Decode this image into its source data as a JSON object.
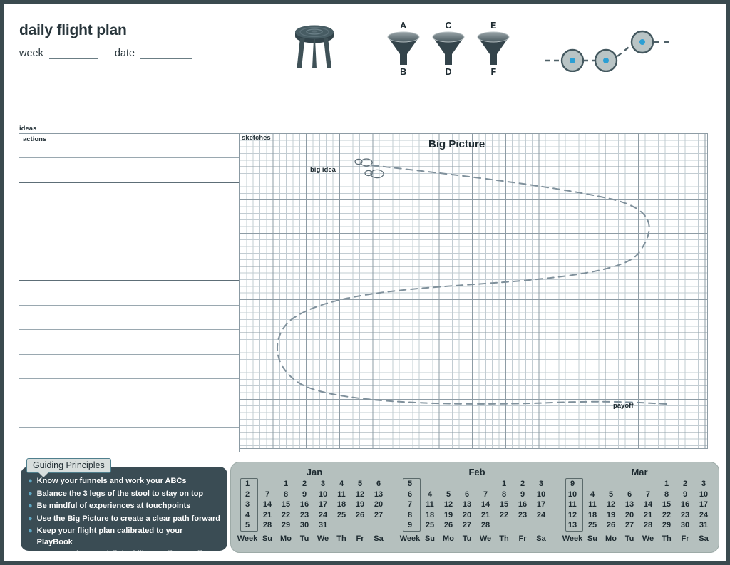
{
  "header": {
    "title": "daily flight plan",
    "week_label": "week",
    "date_label": "date",
    "stool_icon": "three-legged-stool-icon",
    "funnels": [
      {
        "top": "A",
        "bottom": "B"
      },
      {
        "top": "C",
        "bottom": "D"
      },
      {
        "top": "E",
        "bottom": "F"
      }
    ],
    "path_dots_icon": "ascending-path-dots-icon"
  },
  "left_panel": {
    "ideas_label": "ideas",
    "actions_label": "actions",
    "row_count": 13
  },
  "grid_panel": {
    "sketches_label": "sketches",
    "big_picture_title": "Big Picture",
    "big_idea_label": "big idea",
    "payoff_label": "payoff"
  },
  "guiding_principles": {
    "tab_label": "Guiding Principles",
    "items": [
      "Know your funnels and work your ABCs",
      "Balance the 3 legs of the stool to stay on top",
      "Be mindful of experiences at touchpoints",
      "Use the Big Picture to create a clear path forward",
      "Keep your flight plan calibrated to your PlayBook"
    ],
    "footer": "updates at delightability.com/free-stuff"
  },
  "calendars": {
    "week_header": "Week",
    "day_headers": [
      "Su",
      "Mo",
      "Tu",
      "We",
      "Th",
      "Fr",
      "Sa"
    ],
    "months": [
      {
        "name": "Jan",
        "weeks": [
          "1",
          "2",
          "3",
          "4",
          "5"
        ],
        "rows": [
          [
            "",
            "1",
            "2",
            "3",
            "4",
            "5",
            "6"
          ],
          [
            "7",
            "8",
            "9",
            "10",
            "11",
            "12",
            "13"
          ],
          [
            "14",
            "15",
            "16",
            "17",
            "18",
            "19",
            "20"
          ],
          [
            "21",
            "22",
            "23",
            "24",
            "25",
            "26",
            "27"
          ],
          [
            "28",
            "29",
            "30",
            "31",
            "",
            "",
            ""
          ]
        ]
      },
      {
        "name": "Feb",
        "weeks": [
          "5",
          "6",
          "7",
          "8",
          "9"
        ],
        "rows": [
          [
            "",
            "",
            "",
            "",
            "1",
            "2",
            "3"
          ],
          [
            "4",
            "5",
            "6",
            "7",
            "8",
            "9",
            "10"
          ],
          [
            "11",
            "12",
            "13",
            "14",
            "15",
            "16",
            "17"
          ],
          [
            "18",
            "19",
            "20",
            "21",
            "22",
            "23",
            "24"
          ],
          [
            "25",
            "26",
            "27",
            "28",
            "",
            "",
            ""
          ]
        ]
      },
      {
        "name": "Mar",
        "weeks": [
          "9",
          "10",
          "11",
          "12",
          "13"
        ],
        "rows": [
          [
            "",
            "",
            "",
            "",
            "1",
            "2",
            "3"
          ],
          [
            "4",
            "5",
            "6",
            "7",
            "8",
            "9",
            "10"
          ],
          [
            "11",
            "12",
            "13",
            "14",
            "15",
            "16",
            "17"
          ],
          [
            "18",
            "19",
            "20",
            "21",
            "22",
            "23",
            "24"
          ],
          [
            "25",
            "26",
            "27",
            "28",
            "29",
            "30",
            "31"
          ]
        ]
      }
    ]
  },
  "colors": {
    "ink": "#28353b",
    "frame": "#3a4a4f",
    "panel_dark": "#3a4c54",
    "accent_blue": "#5fa8c4",
    "calendar_bg": "#b5c0be",
    "grid_minor": "#c2ccd2",
    "grid_major": "#8e9ca5"
  }
}
